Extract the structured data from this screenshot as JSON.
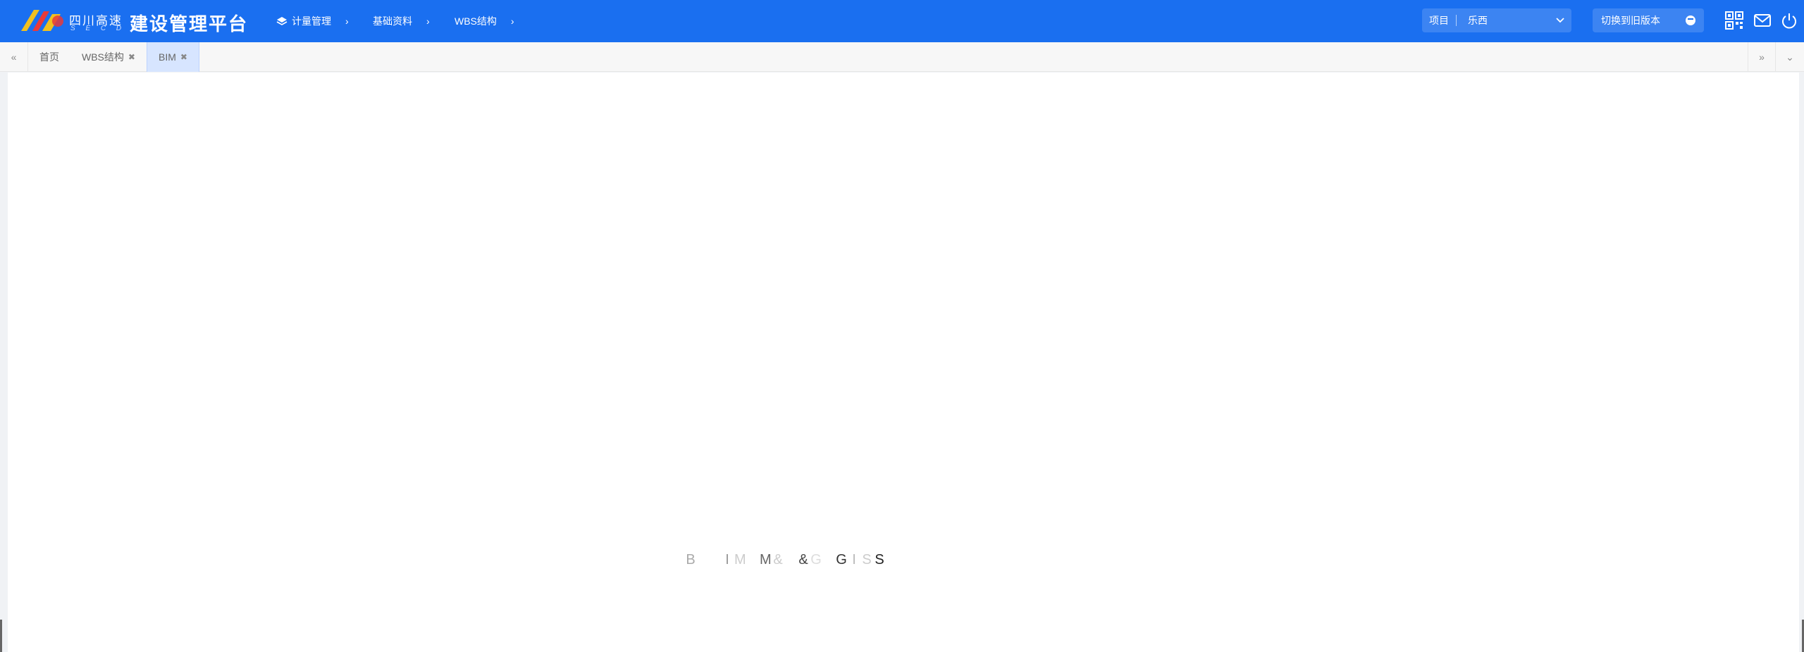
{
  "header": {
    "brand_small": "四川高速",
    "brand_sub": "S E C D G",
    "title": "建设管理平台",
    "breadcrumbs": [
      {
        "label": "计量管理"
      },
      {
        "label": "基础资料"
      },
      {
        "label": "WBS结构"
      }
    ],
    "project_label": "项目",
    "project_value": "乐西",
    "switch_label": "切换到旧版本",
    "accent": "#1a6ff0"
  },
  "tabs": [
    {
      "label": "首页",
      "closable": false
    },
    {
      "label": "WBS结构",
      "closable": true
    },
    {
      "label": "BIM",
      "closable": true,
      "active": true
    }
  ],
  "icons": {
    "tab_prev": "double-left-icon",
    "tab_next": "double-right-icon",
    "tab_menu": "chevron-down-icon",
    "qr": "qr-code-icon",
    "mail": "mail-icon",
    "power": "power-icon"
  },
  "loading": {
    "chars": [
      "",
      "B",
      "",
      "I",
      "M",
      "",
      "M",
      "&",
      "",
      "&",
      "G",
      "",
      "G",
      "I",
      "S",
      "S"
    ]
  }
}
